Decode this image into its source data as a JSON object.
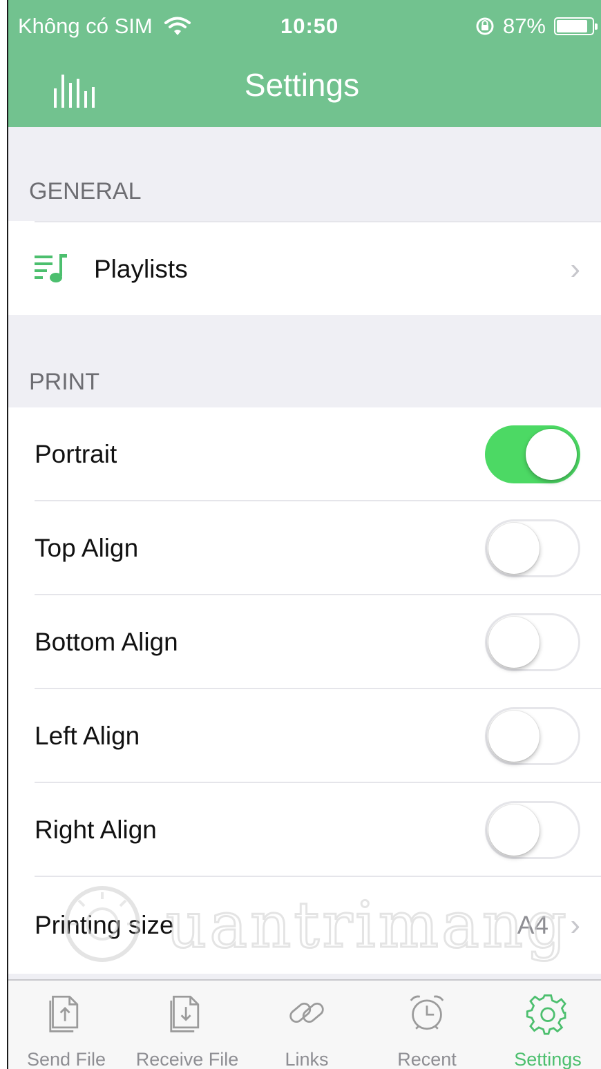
{
  "status_bar": {
    "carrier": "Không có SIM",
    "time": "10:50",
    "battery": "87%",
    "battery_level": 0.87
  },
  "nav": {
    "title": "Settings",
    "left_icon": "equalizer-icon"
  },
  "sections": {
    "general": {
      "header": "GENERAL",
      "items": [
        {
          "label": "Playlists",
          "icon": "playlist-music-icon"
        }
      ]
    },
    "print": {
      "header": "PRINT",
      "toggles": [
        {
          "label": "Portrait",
          "on": true
        },
        {
          "label": "Top Align",
          "on": false
        },
        {
          "label": "Bottom Align",
          "on": false
        },
        {
          "label": "Left Align",
          "on": false
        },
        {
          "label": "Right Align",
          "on": false
        }
      ],
      "printing_size": {
        "label": "Printing size",
        "value": "A4"
      }
    }
  },
  "watermark": "uantrimang",
  "tabs": [
    {
      "label": "Send File",
      "icon": "send-file-icon",
      "active": false
    },
    {
      "label": "Receive File",
      "icon": "receive-file-icon",
      "active": false
    },
    {
      "label": "Links",
      "icon": "link-icon",
      "active": false
    },
    {
      "label": "Recent",
      "icon": "alarm-clock-icon",
      "active": false
    },
    {
      "label": "Settings",
      "icon": "gear-icon",
      "active": true
    }
  ],
  "colors": {
    "header_green": "#72c28f",
    "switch_on": "#4cd964",
    "tab_active": "#4cbf6e",
    "playlist_icon": "#4cbf6e"
  }
}
